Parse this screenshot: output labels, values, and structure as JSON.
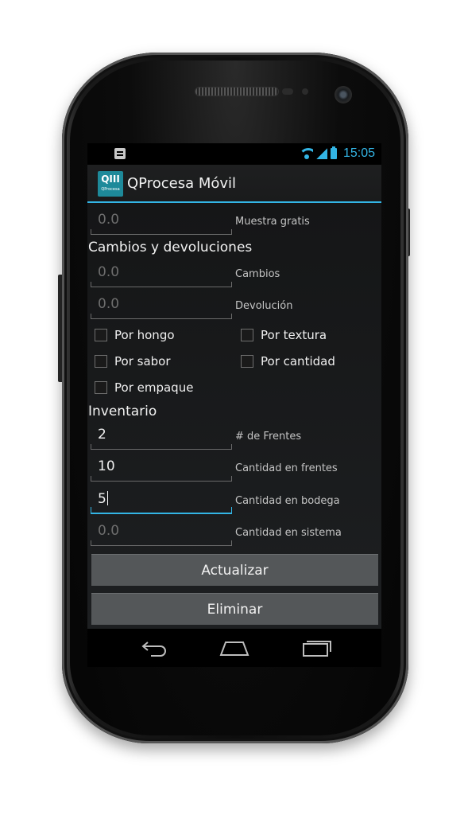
{
  "statusbar": {
    "time": "15:05",
    "icons": [
      "phone-notification-icon",
      "talk-notification-icon",
      "wifi-icon",
      "signal-icon",
      "battery-icon"
    ]
  },
  "actionbar": {
    "logo_text": "QIII",
    "logo_caption": "QProcesa",
    "title": "QProcesa Móvil"
  },
  "form": {
    "muestra_gratis": {
      "value": "0.0",
      "label": "Muestra gratis"
    },
    "cambios_title": "Cambios y devoluciones",
    "cambios": {
      "value": "0.0",
      "label": "Cambios"
    },
    "devolucion": {
      "value": "0.0",
      "label": "Devolución"
    },
    "checks": {
      "por_hongo": "Por hongo",
      "por_textura": "Por textura",
      "por_sabor": "Por sabor",
      "por_cantidad": "Por cantidad",
      "por_empaque": "Por empaque"
    },
    "inventario_title": "Inventario",
    "frentes": {
      "value": "2",
      "label": "# de Frentes"
    },
    "cantidad_frentes": {
      "value": "10",
      "label": "Cantidad en frentes"
    },
    "cantidad_bodega": {
      "value": "5",
      "label": "Cantidad en bodega"
    },
    "cantidad_sistema": {
      "value": "0.0",
      "label": "Cantidad en sistema"
    }
  },
  "buttons": {
    "actualizar": "Actualizar",
    "eliminar": "Eliminar"
  },
  "colors": {
    "accent": "#33b5e5",
    "button_bg": "#545759",
    "logo_bg": "#1e8a9a"
  }
}
